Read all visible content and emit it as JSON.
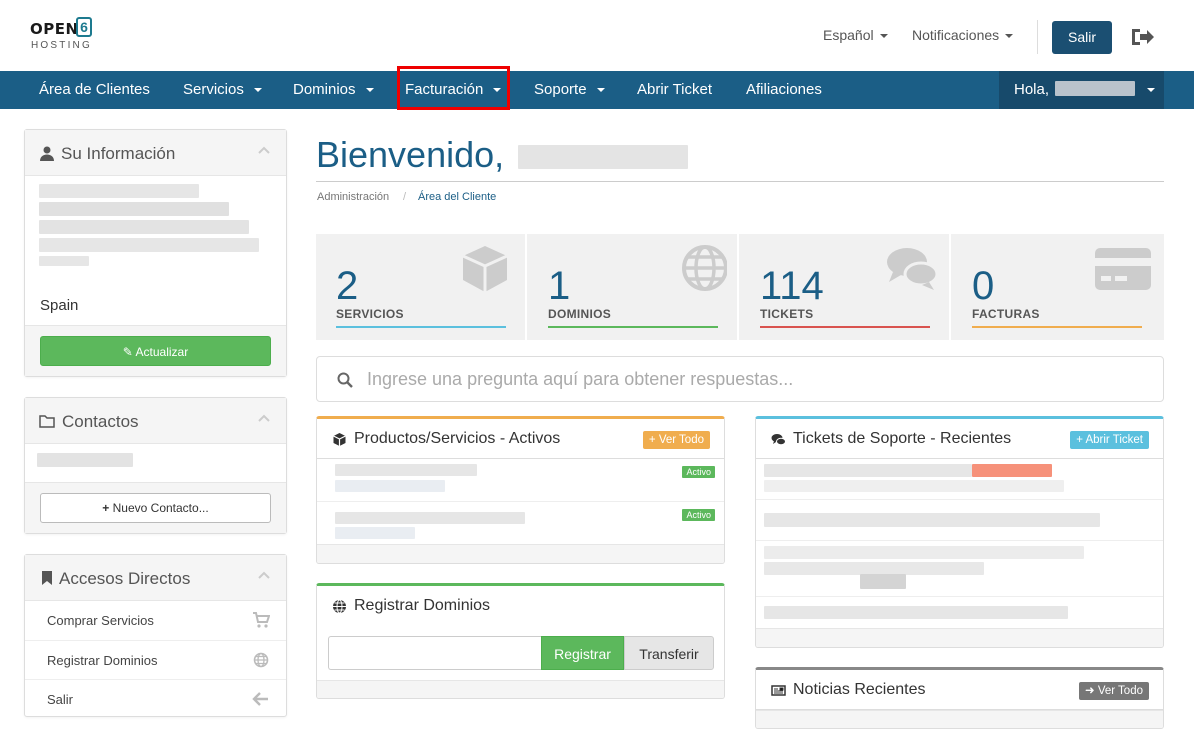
{
  "brand": {
    "logo_word": "OPEN",
    "logo_digit": "6",
    "logo_sub": "HOSTING"
  },
  "topbar": {
    "language": "Español",
    "notifications": "Notificaciones",
    "logout_button": "Salir",
    "exit_icon": "sign-out-icon"
  },
  "nav": {
    "items": [
      {
        "label": "Área de Clientes",
        "dropdown": false
      },
      {
        "label": "Servicios",
        "dropdown": true
      },
      {
        "label": "Dominios",
        "dropdown": true
      },
      {
        "label": "Facturación",
        "dropdown": true,
        "highlighted": true
      },
      {
        "label": "Soporte",
        "dropdown": true
      },
      {
        "label": "Abrir Ticket",
        "dropdown": false
      },
      {
        "label": "Afiliaciones",
        "dropdown": false
      }
    ],
    "greeting": "Hola,"
  },
  "sidebar": {
    "info": {
      "title": "Su Información",
      "country": "Spain",
      "update_button": "Actualizar"
    },
    "contacts": {
      "title": "Contactos",
      "new_contact_button": "Nuevo Contacto..."
    },
    "shortcuts": {
      "title": "Accesos Directos",
      "items": [
        {
          "label": "Comprar Servicios",
          "icon": "cart-icon"
        },
        {
          "label": "Registrar Dominios",
          "icon": "globe-icon"
        },
        {
          "label": "Salir",
          "icon": "arrow-left-icon"
        }
      ]
    }
  },
  "main": {
    "welcome": "Bienvenido,",
    "breadcrumb": [
      "Administración",
      "Área del Cliente"
    ],
    "stats": [
      {
        "value": "2",
        "label": "SERVICIOS",
        "color": "#5bc0de",
        "icon": "cube-icon"
      },
      {
        "value": "1",
        "label": "DOMINIOS",
        "color": "#5cb85c",
        "icon": "globe-icon"
      },
      {
        "value": "114",
        "label": "TICKETS",
        "color": "#d9534f",
        "icon": "comments-icon"
      },
      {
        "value": "0",
        "label": "FACTURAS",
        "color": "#f0ad4e",
        "icon": "credit-card-icon"
      }
    ],
    "search_placeholder": "Ingrese una pregunta aquí para obtener respuestas...",
    "products": {
      "title": "Productos/Servicios - Activos",
      "button": "Ver Todo",
      "status_badge": "Activo"
    },
    "tickets": {
      "title": "Tickets de Soporte - Recientes",
      "button": "Abrir Ticket"
    },
    "domains": {
      "title": "Registrar Dominios",
      "register": "Registrar",
      "transfer": "Transferir"
    },
    "news": {
      "title": "Noticias Recientes",
      "button": "Ver Todo"
    }
  },
  "colors": {
    "primary": "#1b5e86",
    "success": "#5cb85c",
    "warning": "#f0ad4e",
    "info": "#5bc0de",
    "highlight_box": "#e00000"
  }
}
